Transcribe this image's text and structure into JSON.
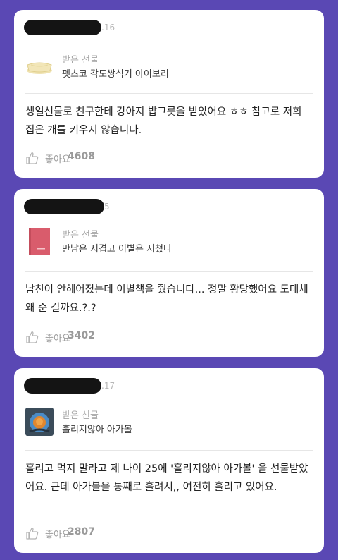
{
  "posts": [
    {
      "date_fragment": ".16",
      "gift_label": "받은 선물",
      "gift_name": "펫츠코 각도쌍식기 아이보리",
      "body": "생일선물로 친구한테 강아지 밥그릇을 받았어요 ㅎㅎ 참고로 저희 집은 개를 키우지 않습니다.",
      "like_label": "좋아요",
      "like_count": "4608"
    },
    {
      "date_fragment": "5",
      "gift_label": "받은 선물",
      "gift_name": "만남은 지겹고 이별은 지쳤다",
      "body": "남친이 안헤어졌는데 이별책을 줬습니다... 정말 황당했어요 도대체 왜 준 걸까요.?.?",
      "like_label": "좋아요",
      "like_count": "3402"
    },
    {
      "date_fragment": ".17",
      "gift_label": "받은 선물",
      "gift_name": "흘리지않아 아가볼",
      "body": "흘리고 먹지 말라고 제 나이 25에 '흘리지않아 아가볼' 을 선물받았어요. 근데 아가볼을 통째로 흘려서,, 여전히 흘리고 있어요.",
      "like_label": "좋아요",
      "like_count": "2807"
    }
  ],
  "icons": {
    "like": "thumbs-up-icon",
    "gift1": "ivory-bowl-thumbnail",
    "gift2": "pink-book-thumbnail",
    "gift3": "baby-bowl-thumbnail"
  },
  "colors": {
    "background": "#5a48b4",
    "card": "#ffffff",
    "redaction": "#141414"
  }
}
